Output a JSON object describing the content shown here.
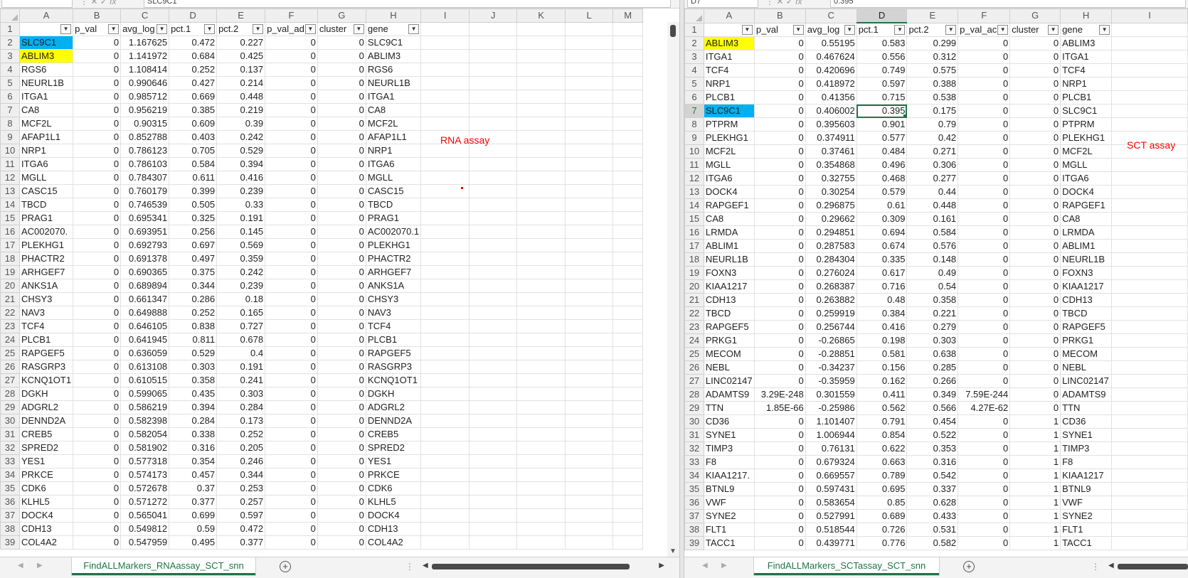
{
  "left": {
    "name_box": "",
    "formula": "SLC9C1",
    "columns": [
      "A",
      "B",
      "C",
      "D",
      "E",
      "F",
      "G",
      "H",
      "I",
      "J",
      "K",
      "L",
      "M"
    ],
    "headers": [
      "",
      "p_val",
      "avg_log",
      "pct.1",
      "pct.2",
      "p_val_ad",
      "cluster",
      "gene"
    ],
    "rows": [
      [
        "SLC9C1",
        "0",
        "1.167625",
        "0.472",
        "0.227",
        "0",
        "0",
        "SLC9C1"
      ],
      [
        "ABLIM3",
        "0",
        "1.141972",
        "0.684",
        "0.425",
        "0",
        "0",
        "ABLIM3"
      ],
      [
        "RGS6",
        "0",
        "1.108414",
        "0.252",
        "0.137",
        "0",
        "0",
        "RGS6"
      ],
      [
        "NEURL1B",
        "0",
        "0.990646",
        "0.427",
        "0.214",
        "0",
        "0",
        "NEURL1B"
      ],
      [
        "ITGA1",
        "0",
        "0.985712",
        "0.669",
        "0.448",
        "0",
        "0",
        "ITGA1"
      ],
      [
        "CA8",
        "0",
        "0.956219",
        "0.385",
        "0.219",
        "0",
        "0",
        "CA8"
      ],
      [
        "MCF2L",
        "0",
        "0.90315",
        "0.609",
        "0.39",
        "0",
        "0",
        "MCF2L"
      ],
      [
        "AFAP1L1",
        "0",
        "0.852788",
        "0.403",
        "0.242",
        "0",
        "0",
        "AFAP1L1"
      ],
      [
        "NRP1",
        "0",
        "0.786123",
        "0.705",
        "0.529",
        "0",
        "0",
        "NRP1"
      ],
      [
        "ITGA6",
        "0",
        "0.786103",
        "0.584",
        "0.394",
        "0",
        "0",
        "ITGA6"
      ],
      [
        "MGLL",
        "0",
        "0.784307",
        "0.611",
        "0.416",
        "0",
        "0",
        "MGLL"
      ],
      [
        "CASC15",
        "0",
        "0.760179",
        "0.399",
        "0.239",
        "0",
        "0",
        "CASC15"
      ],
      [
        "TBCD",
        "0",
        "0.746539",
        "0.505",
        "0.33",
        "0",
        "0",
        "TBCD"
      ],
      [
        "PRAG1",
        "0",
        "0.695341",
        "0.325",
        "0.191",
        "0",
        "0",
        "PRAG1"
      ],
      [
        "AC002070.",
        "0",
        "0.693951",
        "0.256",
        "0.145",
        "0",
        "0",
        "AC002070.1"
      ],
      [
        "PLEKHG1",
        "0",
        "0.692793",
        "0.697",
        "0.569",
        "0",
        "0",
        "PLEKHG1"
      ],
      [
        "PHACTR2",
        "0",
        "0.691378",
        "0.497",
        "0.359",
        "0",
        "0",
        "PHACTR2"
      ],
      [
        "ARHGEF7",
        "0",
        "0.690365",
        "0.375",
        "0.242",
        "0",
        "0",
        "ARHGEF7"
      ],
      [
        "ANKS1A",
        "0",
        "0.689894",
        "0.344",
        "0.239",
        "0",
        "0",
        "ANKS1A"
      ],
      [
        "CHSY3",
        "0",
        "0.661347",
        "0.286",
        "0.18",
        "0",
        "0",
        "CHSY3"
      ],
      [
        "NAV3",
        "0",
        "0.649888",
        "0.252",
        "0.165",
        "0",
        "0",
        "NAV3"
      ],
      [
        "TCF4",
        "0",
        "0.646105",
        "0.838",
        "0.727",
        "0",
        "0",
        "TCF4"
      ],
      [
        "PLCB1",
        "0",
        "0.641945",
        "0.811",
        "0.678",
        "0",
        "0",
        "PLCB1"
      ],
      [
        "RAPGEF5",
        "0",
        "0.636059",
        "0.529",
        "0.4",
        "0",
        "0",
        "RAPGEF5"
      ],
      [
        "RASGRP3",
        "0",
        "0.613108",
        "0.303",
        "0.191",
        "0",
        "0",
        "RASGRP3"
      ],
      [
        "KCNQ1OT1",
        "0",
        "0.610515",
        "0.358",
        "0.241",
        "0",
        "0",
        "KCNQ1OT1"
      ],
      [
        "DGKH",
        "0",
        "0.599065",
        "0.435",
        "0.303",
        "0",
        "0",
        "DGKH"
      ],
      [
        "ADGRL2",
        "0",
        "0.586219",
        "0.394",
        "0.284",
        "0",
        "0",
        "ADGRL2"
      ],
      [
        "DENND2A",
        "0",
        "0.582398",
        "0.284",
        "0.173",
        "0",
        "0",
        "DENND2A"
      ],
      [
        "CREB5",
        "0",
        "0.582054",
        "0.338",
        "0.252",
        "0",
        "0",
        "CREB5"
      ],
      [
        "SPRED2",
        "0",
        "0.581902",
        "0.316",
        "0.205",
        "0",
        "0",
        "SPRED2"
      ],
      [
        "YES1",
        "0",
        "0.577318",
        "0.354",
        "0.246",
        "0",
        "0",
        "YES1"
      ],
      [
        "PRKCE",
        "0",
        "0.574173",
        "0.457",
        "0.344",
        "0",
        "0",
        "PRKCE"
      ],
      [
        "CDK6",
        "0",
        "0.572678",
        "0.37",
        "0.253",
        "0",
        "0",
        "CDK6"
      ],
      [
        "KLHL5",
        "0",
        "0.571272",
        "0.377",
        "0.257",
        "0",
        "0",
        "KLHL5"
      ],
      [
        "DOCK4",
        "0",
        "0.565041",
        "0.699",
        "0.597",
        "0",
        "0",
        "DOCK4"
      ],
      [
        "CDH13",
        "0",
        "0.549812",
        "0.59",
        "0.472",
        "0",
        "0",
        "CDH13"
      ],
      [
        "COL4A2",
        "0",
        "0.547959",
        "0.495",
        "0.377",
        "0",
        "0",
        "COL4A2"
      ]
    ],
    "annotation": "RNA assay",
    "sheet_tab": "FindALLMarkers_RNAassay_SCT_snn"
  },
  "right": {
    "name_box": "D7",
    "formula": "0.395",
    "columns": [
      "A",
      "B",
      "C",
      "D",
      "E",
      "F",
      "G",
      "H",
      "I"
    ],
    "headers": [
      "",
      "p_val",
      "avg_log",
      "pct.1",
      "pct.2",
      "p_val_ac",
      "cluster",
      "gene"
    ],
    "rows": [
      [
        "ABLIM3",
        "0",
        "0.55195",
        "0.583",
        "0.299",
        "0",
        "0",
        "ABLIM3"
      ],
      [
        "ITGA1",
        "0",
        "0.467624",
        "0.556",
        "0.312",
        "0",
        "0",
        "ITGA1"
      ],
      [
        "TCF4",
        "0",
        "0.420696",
        "0.749",
        "0.575",
        "0",
        "0",
        "TCF4"
      ],
      [
        "NRP1",
        "0",
        "0.418972",
        "0.597",
        "0.388",
        "0",
        "0",
        "NRP1"
      ],
      [
        "PLCB1",
        "0",
        "0.41356",
        "0.715",
        "0.538",
        "0",
        "0",
        "PLCB1"
      ],
      [
        "SLC9C1",
        "0",
        "0.406002",
        "0.395",
        "0.175",
        "0",
        "0",
        "SLC9C1"
      ],
      [
        "PTPRM",
        "0",
        "0.395603",
        "0.901",
        "0.79",
        "0",
        "0",
        "PTPRM"
      ],
      [
        "PLEKHG1",
        "0",
        "0.374911",
        "0.577",
        "0.42",
        "0",
        "0",
        "PLEKHG1"
      ],
      [
        "MCF2L",
        "0",
        "0.37461",
        "0.484",
        "0.271",
        "0",
        "0",
        "MCF2L"
      ],
      [
        "MGLL",
        "0",
        "0.354868",
        "0.496",
        "0.306",
        "0",
        "0",
        "MGLL"
      ],
      [
        "ITGA6",
        "0",
        "0.32755",
        "0.468",
        "0.277",
        "0",
        "0",
        "ITGA6"
      ],
      [
        "DOCK4",
        "0",
        "0.30254",
        "0.579",
        "0.44",
        "0",
        "0",
        "DOCK4"
      ],
      [
        "RAPGEF1",
        "0",
        "0.296875",
        "0.61",
        "0.448",
        "0",
        "0",
        "RAPGEF1"
      ],
      [
        "CA8",
        "0",
        "0.29662",
        "0.309",
        "0.161",
        "0",
        "0",
        "CA8"
      ],
      [
        "LRMDA",
        "0",
        "0.294851",
        "0.694",
        "0.584",
        "0",
        "0",
        "LRMDA"
      ],
      [
        "ABLIM1",
        "0",
        "0.287583",
        "0.674",
        "0.576",
        "0",
        "0",
        "ABLIM1"
      ],
      [
        "NEURL1B",
        "0",
        "0.284304",
        "0.335",
        "0.148",
        "0",
        "0",
        "NEURL1B"
      ],
      [
        "FOXN3",
        "0",
        "0.276024",
        "0.617",
        "0.49",
        "0",
        "0",
        "FOXN3"
      ],
      [
        "KIAA1217",
        "0",
        "0.268387",
        "0.716",
        "0.54",
        "0",
        "0",
        "KIAA1217"
      ],
      [
        "CDH13",
        "0",
        "0.263882",
        "0.48",
        "0.358",
        "0",
        "0",
        "CDH13"
      ],
      [
        "TBCD",
        "0",
        "0.259919",
        "0.384",
        "0.221",
        "0",
        "0",
        "TBCD"
      ],
      [
        "RAPGEF5",
        "0",
        "0.256744",
        "0.416",
        "0.279",
        "0",
        "0",
        "RAPGEF5"
      ],
      [
        "PRKG1",
        "0",
        "-0.26865",
        "0.198",
        "0.303",
        "0",
        "0",
        "PRKG1"
      ],
      [
        "MECOM",
        "0",
        "-0.28851",
        "0.581",
        "0.638",
        "0",
        "0",
        "MECOM"
      ],
      [
        "NEBL",
        "0",
        "-0.34237",
        "0.156",
        "0.285",
        "0",
        "0",
        "NEBL"
      ],
      [
        "LINC02147",
        "0",
        "-0.35959",
        "0.162",
        "0.266",
        "0",
        "0",
        "LINC02147"
      ],
      [
        "ADAMTS9",
        "3.29E-248",
        "0.301559",
        "0.411",
        "0.349",
        "7.59E-244",
        "0",
        "ADAMTS9"
      ],
      [
        "TTN",
        "1.85E-66",
        "-0.25986",
        "0.562",
        "0.566",
        "4.27E-62",
        "0",
        "TTN"
      ],
      [
        "CD36",
        "0",
        "1.101407",
        "0.791",
        "0.454",
        "0",
        "1",
        "CD36"
      ],
      [
        "SYNE1",
        "0",
        "1.006944",
        "0.854",
        "0.522",
        "0",
        "1",
        "SYNE1"
      ],
      [
        "TIMP3",
        "0",
        "0.76131",
        "0.622",
        "0.353",
        "0",
        "1",
        "TIMP3"
      ],
      [
        "F8",
        "0",
        "0.679324",
        "0.663",
        "0.316",
        "0",
        "1",
        "F8"
      ],
      [
        "KIAA1217.",
        "0",
        "0.669557",
        "0.789",
        "0.542",
        "0",
        "1",
        "KIAA1217"
      ],
      [
        "BTNL9",
        "0",
        "0.597431",
        "0.695",
        "0.337",
        "0",
        "1",
        "BTNL9"
      ],
      [
        "VWF",
        "0",
        "0.583654",
        "0.85",
        "0.628",
        "0",
        "1",
        "VWF"
      ],
      [
        "SYNE2",
        "0",
        "0.527991",
        "0.689",
        "0.433",
        "0",
        "1",
        "SYNE2"
      ],
      [
        "FLT1",
        "0",
        "0.518544",
        "0.726",
        "0.531",
        "0",
        "1",
        "FLT1"
      ],
      [
        "TACC1",
        "0",
        "0.439771",
        "0.776",
        "0.582",
        "0",
        "1",
        "TACC1"
      ]
    ],
    "annotation": "SCT assay",
    "sheet_tab": "FindALLMarkers_SCTassay_SCT_snn"
  },
  "colors": {
    "highlight_blue": "#00b0f0",
    "highlight_yellow": "#ffff00",
    "annotation_red": "#ff0000",
    "accent_green": "#217346"
  },
  "icons": [
    "filter-dropdown-icon",
    "add-sheet-icon",
    "scroll-arrow-icon",
    "fx-icon"
  ]
}
